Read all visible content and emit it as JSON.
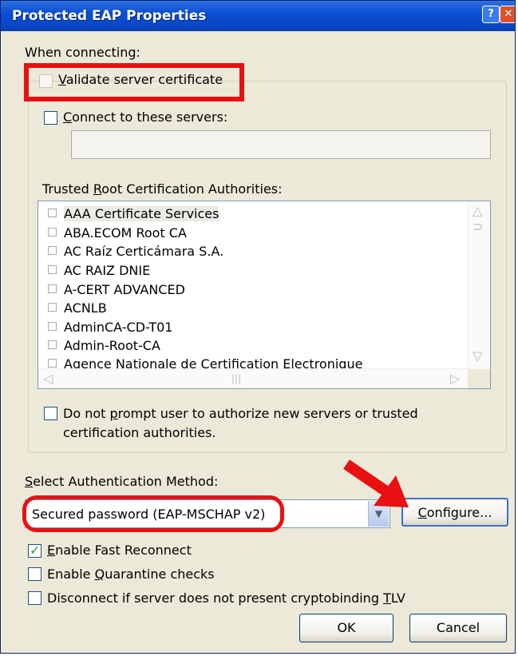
{
  "title": "Protected EAP Properties",
  "when_connecting": "When connecting:",
  "validate_cert": {
    "label": "Validate server certificate",
    "mnemonic": "V",
    "rest": "alidate server certificate",
    "checked": false
  },
  "connect_servers": {
    "mnemonic": "C",
    "rest": "onnect to these servers:",
    "checked": false,
    "value": ""
  },
  "trusted_root": {
    "pre": "Trusted ",
    "mnemonic": "R",
    "rest": "oot Certification Authorities:"
  },
  "ca_list": [
    "AAA Certificate Services",
    "ABA.ECOM Root CA",
    "AC Raíz Certicámara S.A.",
    "AC RAIZ DNIE",
    "A-CERT ADVANCED",
    "ACNLB",
    "AdminCA-CD-T01",
    "Admin-Root-CA",
    "Agence Nationale de Certification Electronique"
  ],
  "no_prompt": {
    "line1_pre": "Do not ",
    "mnemonic": "p",
    "line1_rest": "rompt user to authorize new servers or trusted",
    "line2": "certification authorities.",
    "checked": false
  },
  "select_auth": {
    "mnemonic": "S",
    "rest": "elect Authentication Method:"
  },
  "auth_method": "Secured password (EAP-MSCHAP v2)",
  "configure": {
    "mnemonic": "C",
    "rest": "onfigure..."
  },
  "fast_reconnect": {
    "mnemonic": "E",
    "rest": "nable Fast Reconnect",
    "checked": true
  },
  "quarantine": {
    "pre": "Enable ",
    "mnemonic": "Q",
    "rest": "uarantine checks",
    "checked": false
  },
  "cryptobinding": {
    "pre": "Disconnect if server does not present cryptobinding ",
    "mnemonic": "T",
    "rest": "LV",
    "checked": false
  },
  "ok": "OK",
  "cancel": "Cancel",
  "colors": {
    "annotation": "#e81010",
    "title_bar": "#0a4fd4"
  }
}
